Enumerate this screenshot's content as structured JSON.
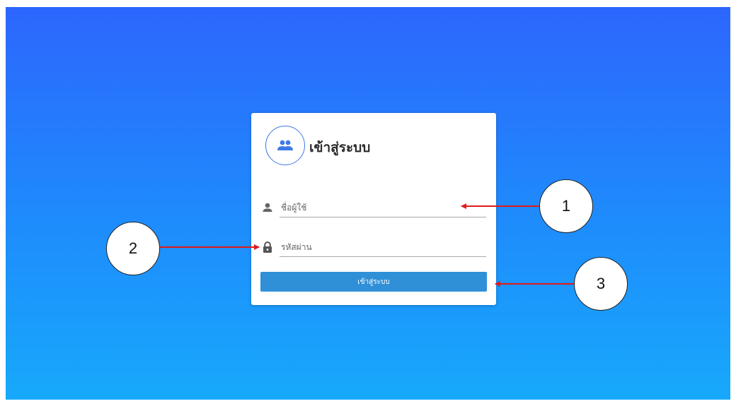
{
  "login_card": {
    "title": "เข้าสู่ระบบ",
    "logo_icon": "group-icon",
    "username": {
      "icon": "user-icon",
      "value": "",
      "placeholder": "ชื่อผู้ใช้"
    },
    "password": {
      "icon": "lock-icon",
      "value": "",
      "placeholder": "รหัสผ่าน"
    },
    "submit_label": "เข้าสู่ระบบ"
  },
  "annotations": [
    {
      "label": "1"
    },
    {
      "label": "2"
    },
    {
      "label": "3"
    }
  ],
  "colors": {
    "gradient_top": "#2d66fd",
    "gradient_bottom": "#17a9fb",
    "button": "#2f90d8",
    "logo_accent": "#3f7ae6",
    "arrow": "#e01a1a"
  }
}
